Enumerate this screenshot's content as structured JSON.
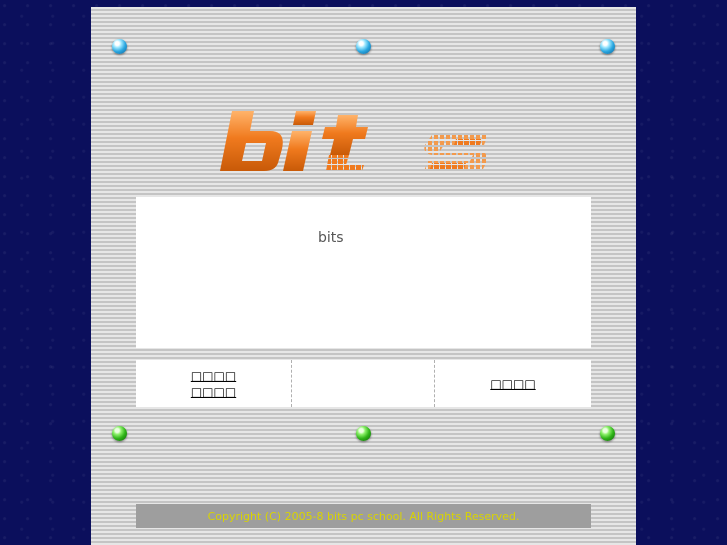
{
  "header": {
    "logo_text": "bits"
  },
  "content": {
    "text": "bits"
  },
  "nav": {
    "left_line1": "□□□□",
    "left_line2": "□□□□",
    "right_label": "□□□□"
  },
  "footer": {
    "copyright": "Copyright (C) 2005-8 bits pc school. All Rights Reserved."
  },
  "colors": {
    "background": "#0b0f5c",
    "panel": "#d6d6d6",
    "logo_orange": "#f07a1e",
    "copyright_text": "#d9d400"
  },
  "icons": {
    "top_rivets": "blue-rivet-icon",
    "bottom_rivets": "green-rivet-icon"
  }
}
